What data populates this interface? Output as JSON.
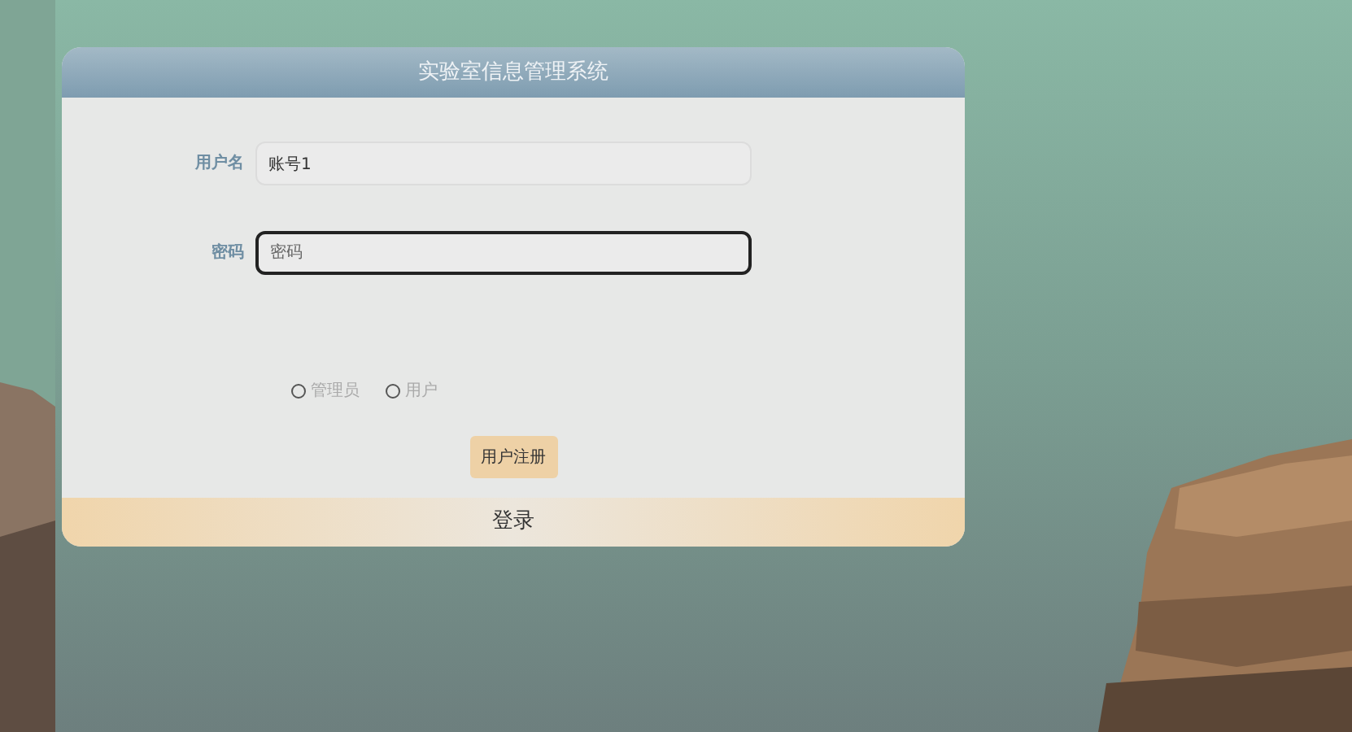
{
  "title": "实验室信息管理系统",
  "fields": [
    {
      "label": "用户名",
      "value": "账号1",
      "focused": false
    },
    {
      "label": "密码",
      "placeholder": "密码",
      "focused": true
    }
  ],
  "roles": [
    {
      "label": "管理员",
      "selected": false
    },
    {
      "label": "用户",
      "selected": false
    }
  ],
  "register_button": "用户注册",
  "login_button": "登录"
}
